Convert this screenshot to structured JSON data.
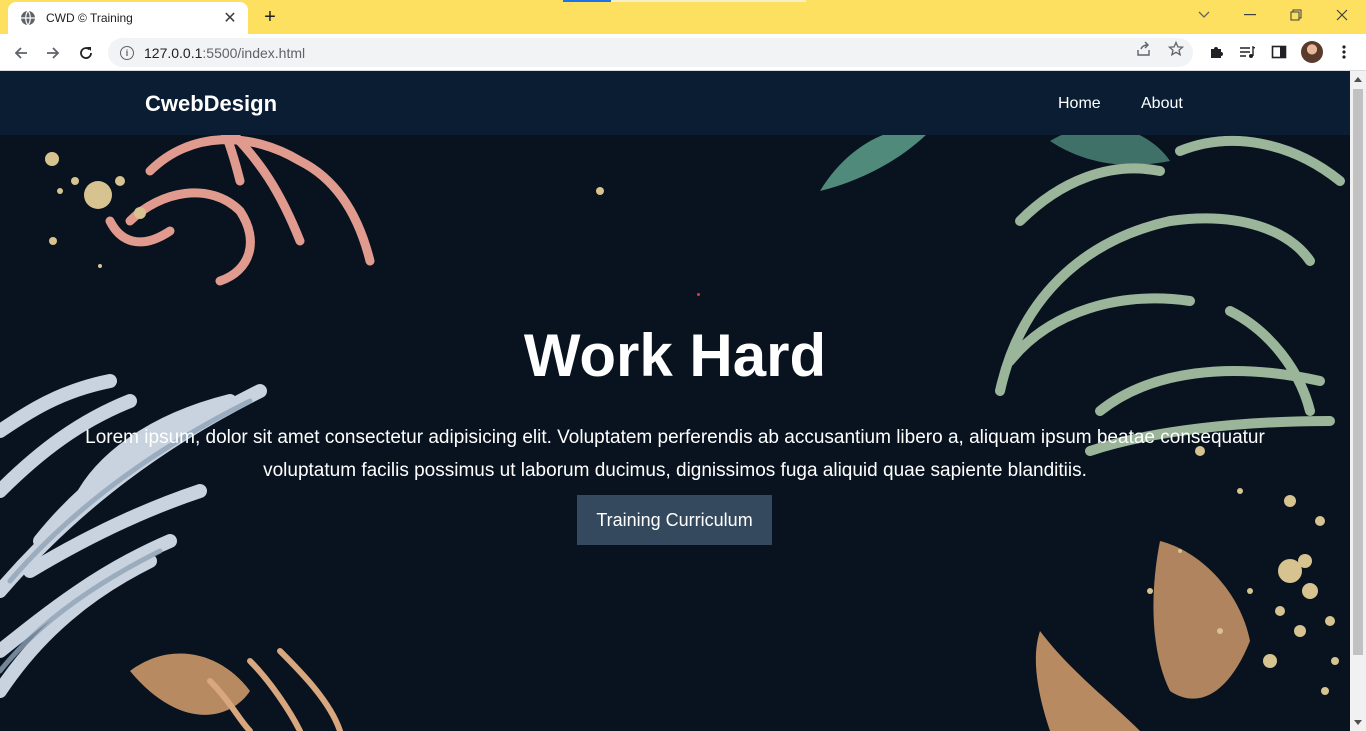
{
  "browser": {
    "tab_title": "CWD © Training",
    "url_host": "127.0.0.1",
    "url_path": ":5500/index.html",
    "icons": [
      "globe-icon",
      "close-icon",
      "plus-icon",
      "back-icon",
      "forward-icon",
      "reload-icon",
      "info-icon",
      "share-icon",
      "star-icon",
      "puzzle-icon",
      "media-icon",
      "side-panel-icon",
      "kebab-menu-icon",
      "chevron-down-icon",
      "minimize-icon",
      "restore-icon",
      "window-close-icon"
    ]
  },
  "site": {
    "brand": "CwebDesign",
    "nav": [
      {
        "label": "Home"
      },
      {
        "label": "About"
      }
    ]
  },
  "hero": {
    "title": "Work Hard",
    "text": "Lorem ipsum, dolor sit amet consectetur adipisicing elit. Voluptatem perferendis ab accusantium libero a, aliquam ipsum beatae consequatur voluptatum facilis possimus ut laborum ducimus, dignissimos fuga aliquid quae sapiente blanditiis.",
    "cta": "Training Curriculum"
  },
  "colors": {
    "tab_strip": "#fde05f",
    "nav_bg": "#0a1d33",
    "hero_bg": "#08131f",
    "cta_bg": "#34495e"
  }
}
